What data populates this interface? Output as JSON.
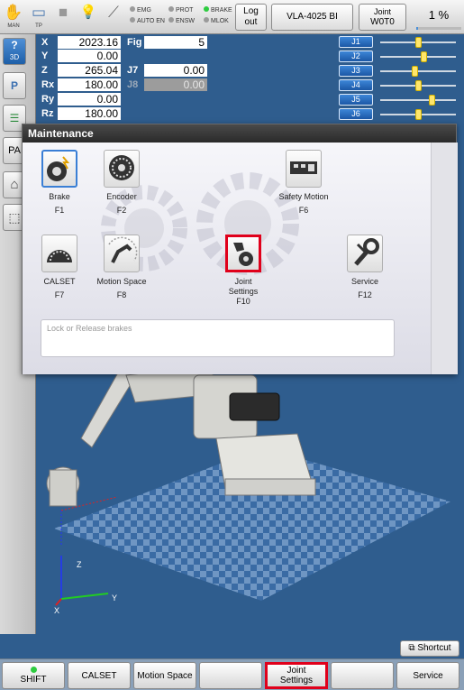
{
  "topbar": {
    "icons": [
      {
        "name": "hand-icon",
        "glyph": "✋",
        "label": "MAN"
      },
      {
        "name": "teach-pendant-icon",
        "glyph": "▭",
        "label": "TP"
      },
      {
        "name": "stop-square-icon",
        "glyph": "■",
        "label": ""
      },
      {
        "name": "lightbulb-icon",
        "glyph": "💡",
        "label": ""
      },
      {
        "name": "wrench-icon",
        "glyph": "⟋",
        "label": ""
      }
    ],
    "status_col1": [
      {
        "label": "EMG",
        "on": false
      },
      {
        "label": "AUTO EN",
        "on": false
      }
    ],
    "status_col2": [
      {
        "label": "PROT",
        "on": false
      },
      {
        "label": "ENSW",
        "on": false
      }
    ],
    "status_col3": [
      {
        "label": "BRAKE",
        "on": true
      },
      {
        "label": "MLOK",
        "on": false
      }
    ],
    "logout_label_1": "Log",
    "logout_label_2": "out",
    "robot_name": "VLA-4025 BI",
    "joint_label": "Joint",
    "joint_value": "W0T0",
    "speed": "1 %",
    "speed_fraction": 0.01
  },
  "sidebar": {
    "items": [
      {
        "name": "view-3d-button",
        "glyph": "?",
        "label": "3D"
      },
      {
        "name": "pose-button",
        "glyph": "P",
        "label": ""
      },
      {
        "name": "list-button",
        "glyph": "☰",
        "label": ""
      },
      {
        "name": "pa-button",
        "glyph": "",
        "label": "PA"
      },
      {
        "name": "home-button",
        "glyph": "⌂",
        "label": ""
      },
      {
        "name": "box-button",
        "glyph": "⬚",
        "label": ""
      }
    ]
  },
  "coords": {
    "rows": [
      {
        "label": "X",
        "value": "2023.16"
      },
      {
        "label": "Y",
        "value": "0.00"
      },
      {
        "label": "Z",
        "value": "265.04"
      },
      {
        "label": "Rx",
        "value": "180.00"
      },
      {
        "label": "Ry",
        "value": "0.00"
      },
      {
        "label": "Rz",
        "value": "180.00"
      }
    ],
    "fig_label": "Fig",
    "fig_value": "5",
    "j7_label": "J7",
    "j7_value": "0.00",
    "j8_label": "J8",
    "j8_value": "0.00"
  },
  "joints": [
    {
      "label": "J1",
      "level": 0.5
    },
    {
      "label": "J2",
      "level": 0.58
    },
    {
      "label": "J3",
      "level": 0.46
    },
    {
      "label": "J4",
      "level": 0.5
    },
    {
      "label": "J5",
      "level": 0.68
    },
    {
      "label": "J6",
      "level": 0.5
    }
  ],
  "dialog": {
    "title": "Maintenance",
    "tiles": [
      {
        "name": "brake-tile",
        "label": "Brake",
        "fkey": "F1"
      },
      {
        "name": "encoder-tile",
        "label": "Encoder",
        "fkey": "F2"
      },
      {
        "name": "safety-motion-tile",
        "label": "Safety Motion",
        "fkey": "F6"
      },
      {
        "name": "calset-tile",
        "label": "CALSET",
        "fkey": "F7"
      },
      {
        "name": "motion-space-tile",
        "label": "Motion Space",
        "fkey": "F8"
      },
      {
        "name": "joint-settings-tile",
        "label": "Joint Settings",
        "fkey": "F10"
      },
      {
        "name": "service-tile",
        "label": "Service",
        "fkey": "F12"
      }
    ],
    "description": "Lock or Release brakes"
  },
  "viewport": {
    "axis_x": "X",
    "axis_y": "Y",
    "axis_z": "Z"
  },
  "shortcut_label": "Shortcut",
  "bottom": {
    "shift": "SHIFT",
    "calset": "CALSET",
    "motion_space": "Motion Space",
    "blank1": "",
    "joint_settings_1": "Joint",
    "joint_settings_2": "Settings",
    "blank2": "",
    "service": "Service"
  }
}
